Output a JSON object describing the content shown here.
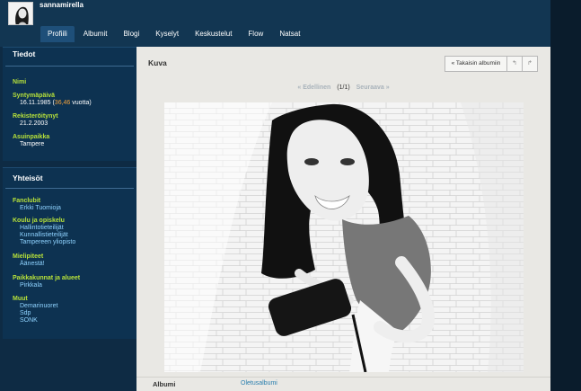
{
  "header": {
    "username": "sannamirella",
    "tabs": [
      {
        "label": "Profiili",
        "active": true
      },
      {
        "label": "Albumit",
        "active": false
      },
      {
        "label": "Blogi",
        "active": false
      },
      {
        "label": "Kyselyt",
        "active": false
      },
      {
        "label": "Keskustelut",
        "active": false
      },
      {
        "label": "Flow",
        "active": false
      },
      {
        "label": "Natsat",
        "active": false
      }
    ]
  },
  "tiedot": {
    "title": "Tiedot",
    "nimi_label": "Nimi",
    "birthday_label": "Syntymäpäivä",
    "birthday_date": "16.11.1985 (",
    "birthday_age": "36,46",
    "birthday_suffix": " vuotta)",
    "registered_label": "Rekisteröitynyt",
    "registered_value": "21.2.2003",
    "city_label": "Asuinpaikka",
    "city_value": "Tampere"
  },
  "yhteisot": {
    "title": "Yhteisöt",
    "fanclubs_label": "Fanclubit",
    "fanclubs": [
      "Erkki Tuomioja"
    ],
    "school_label": "Koulu ja opiskelu",
    "school": [
      "Hallintotieteilijät",
      "Kunnallistieteilijät",
      "Tampereen yliopisto"
    ],
    "opinions_label": "Mielipiteet",
    "opinions": [
      "Äänestä!"
    ],
    "places_label": "Paikkakunnat ja alueet",
    "places": [
      "Pirkkala"
    ],
    "other_label": "Muut",
    "other": [
      "Demarinuoret",
      "Sdp",
      "SONK"
    ]
  },
  "main": {
    "title": "Kuva",
    "back_button": "« Takaisin albumiin",
    "rotate_left": "↰",
    "rotate_right": "↱",
    "prev": "« Edellinen",
    "counter": "(1/1)",
    "next": "Seuraava »",
    "album_label": "Albumi",
    "album_value": "Oletusalbumi"
  },
  "colors": {
    "page_bg": "#0e2b44",
    "header_bg": "#123652",
    "sidebar_bg": "#0d3251",
    "label_green": "#b8e23a",
    "link_blue": "#8fd3ff",
    "age_orange": "#f6a33b",
    "main_bg": "#e9e8e4"
  }
}
